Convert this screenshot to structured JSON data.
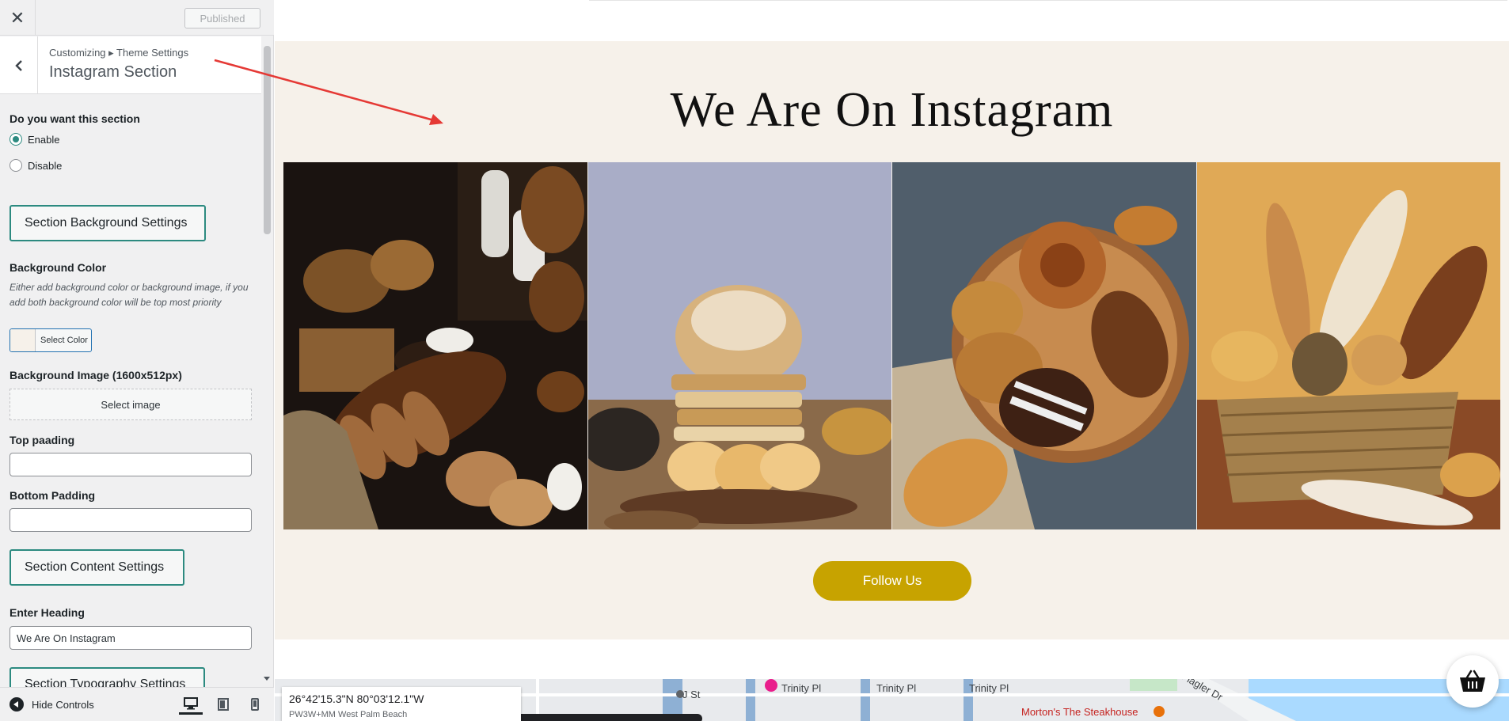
{
  "topbar": {
    "close_label": "✕",
    "publish_label": "Published"
  },
  "header": {
    "breadcrumb": "Customizing ▸ Theme Settings",
    "title": "Instagram Section"
  },
  "section_toggle": {
    "label": "Do you want this section",
    "options": [
      {
        "label": "Enable",
        "selected": true
      },
      {
        "label": "Disable",
        "selected": false
      }
    ]
  },
  "background_settings": {
    "group_label": "Section Background Settings",
    "color_label": "Background Color",
    "color_desc": "Either add background color or background image, if you add both background color will be top most priority",
    "color_button": "Select Color",
    "color_value": "#f6f1ea",
    "image_label": "Background Image (1600x512px)",
    "image_button": "Select image",
    "top_padding_label": "Top paading",
    "top_padding_value": "",
    "bottom_padding_label": "Bottom Padding",
    "bottom_padding_value": ""
  },
  "content_settings": {
    "group_label": "Section Content Settings",
    "heading_label": "Enter Heading",
    "heading_value": "We Are On Instagram"
  },
  "typography_settings": {
    "group_label": "Section Typography Settings"
  },
  "footer": {
    "hide_controls": "Hide Controls"
  },
  "preview": {
    "heading": "We Are On Instagram",
    "follow_button": "Follow Us",
    "accent_color": "#c7a300",
    "section_bg": "#f6f1ea"
  },
  "map": {
    "coordinates": "26°42'15.3\"N 80°03'12.1\"W",
    "plus_code": "PW3W+MM West Palm Beach",
    "labels": [
      "J St",
      "Trinity Pl",
      "Trinity Pl",
      "Trinity Pl",
      "Morton's The Steakhouse",
      "Flagler Dr"
    ]
  }
}
